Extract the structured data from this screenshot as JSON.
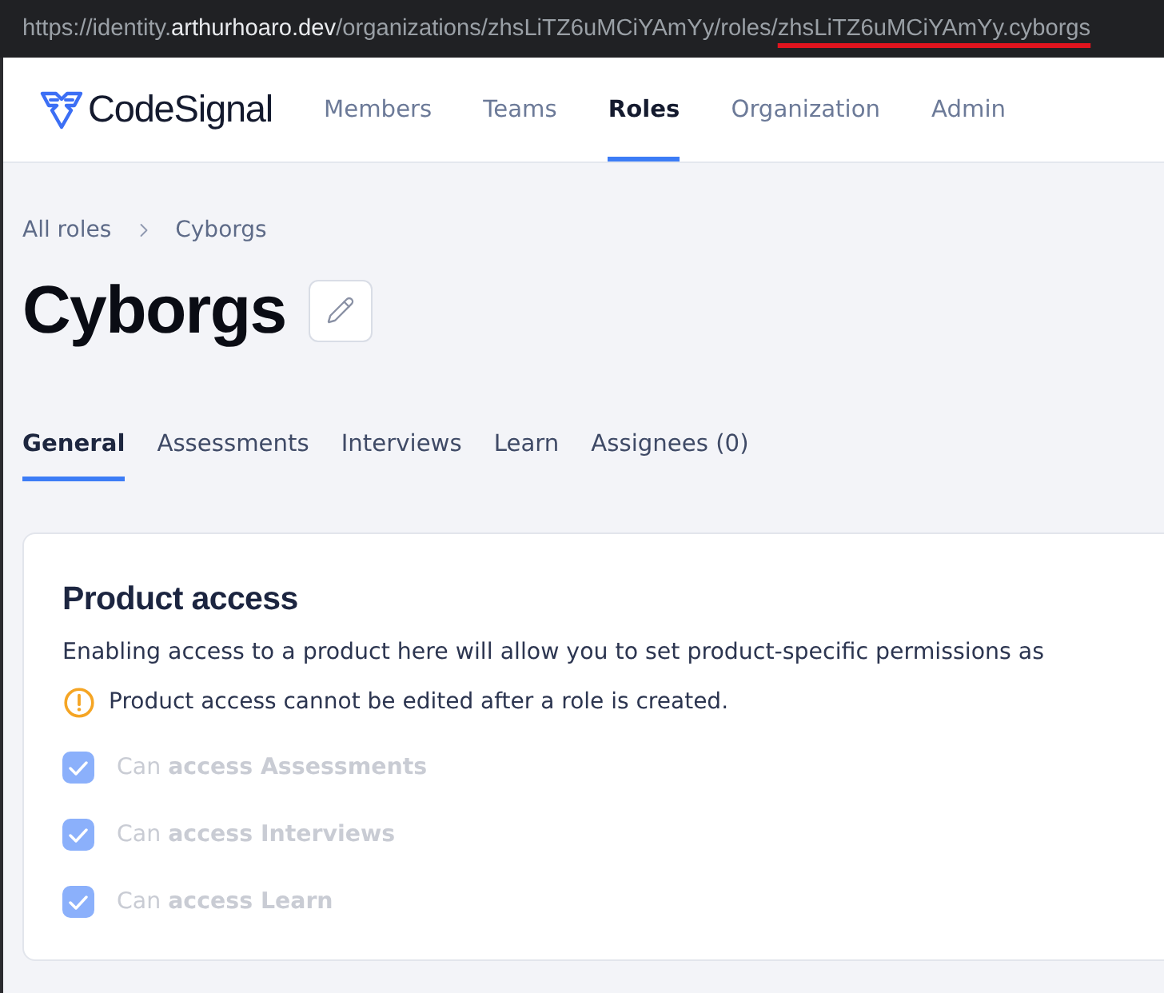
{
  "browser": {
    "address_parts": [
      {
        "text": "https://identity.",
        "kind": "dim"
      },
      {
        "text": "arthurhoaro.dev",
        "kind": "host"
      },
      {
        "text": "/organizations/zhsLiTZ6uMCiYAmYy/roles/",
        "kind": "dim"
      },
      {
        "text": "zhsLiTZ6uMCiYAmYy.cyborgs",
        "kind": "underlined"
      }
    ]
  },
  "nav": {
    "logo_text": "CodeSignal",
    "items": [
      {
        "label": "Members",
        "selected": false
      },
      {
        "label": "Teams",
        "selected": false
      },
      {
        "label": "Roles",
        "selected": true
      },
      {
        "label": "Organization",
        "selected": false
      },
      {
        "label": "Admin",
        "selected": false
      }
    ]
  },
  "breadcrumb": [
    {
      "label": "All roles"
    },
    {
      "label": "Cyborgs"
    }
  ],
  "title": "Cyborgs",
  "tabs": [
    {
      "label": "General",
      "selected": true
    },
    {
      "label": "Assessments",
      "selected": false
    },
    {
      "label": "Interviews",
      "selected": false
    },
    {
      "label": "Learn",
      "selected": false
    },
    {
      "label": "Assignees (0)",
      "selected": false
    }
  ],
  "product_access": {
    "title": "Product access",
    "description": "Enabling access to a product here will allow you to set product-specific permissions as",
    "warning": "Product access cannot be edited after a role is created.",
    "permissions": [
      {
        "text": "Can **access Assessments**",
        "checked": true,
        "disabled": true
      },
      {
        "text": "Can **access Interviews**",
        "checked": true,
        "disabled": true
      },
      {
        "text": "Can **access Learn**",
        "checked": true,
        "disabled": true
      }
    ]
  }
}
